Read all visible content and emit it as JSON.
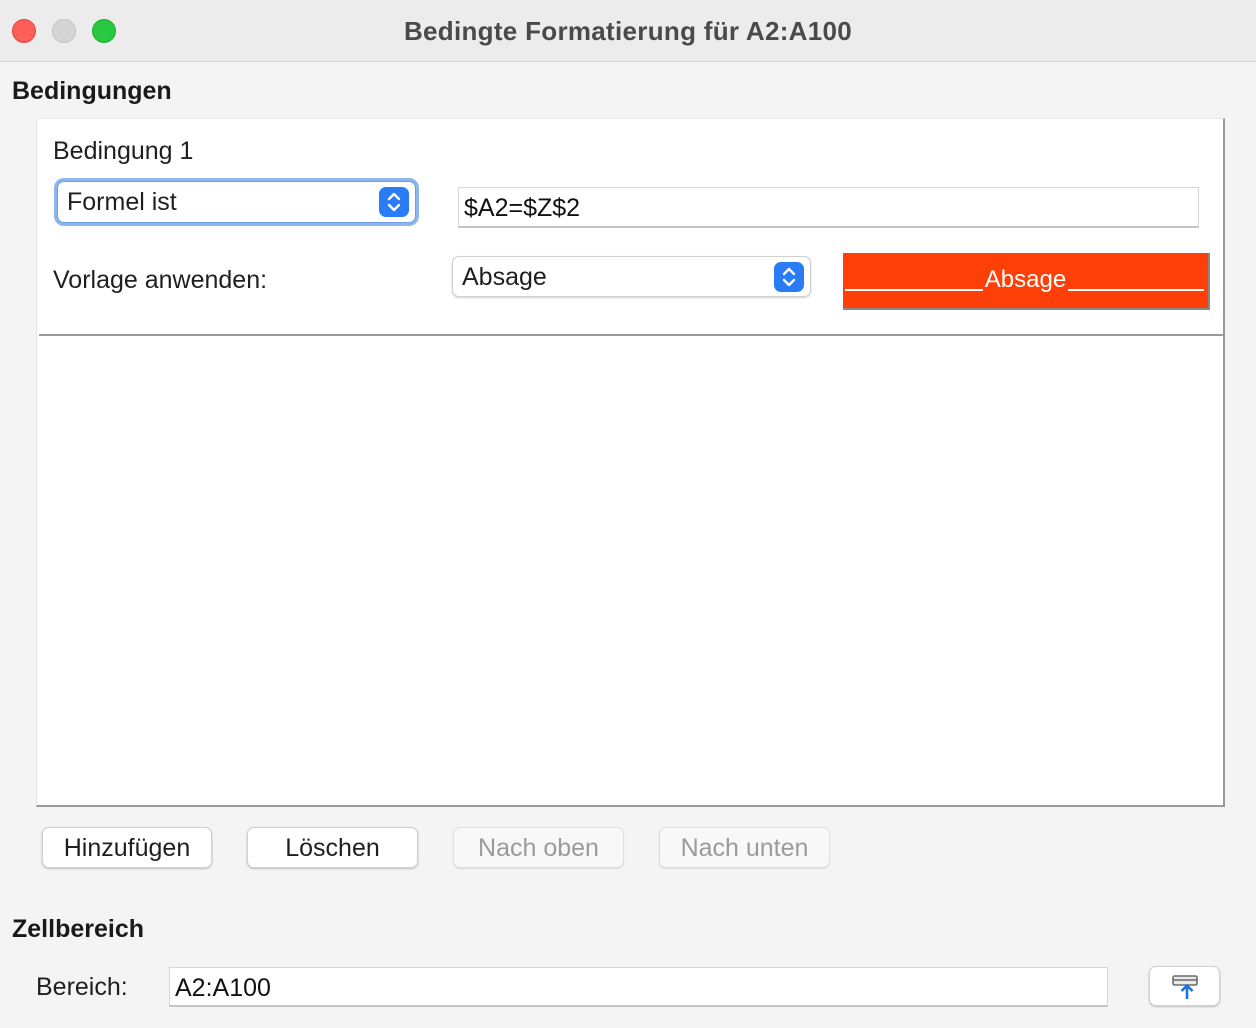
{
  "window": {
    "title": "Bedingte Formatierung für A2:A100"
  },
  "conditions": {
    "heading": "Bedingungen",
    "items": [
      {
        "label": "Bedingung 1",
        "type_selected": "Formel ist",
        "formula": "$A2=$Z$2",
        "style_label": "Vorlage anwenden:",
        "style_selected": "Absage",
        "preview_text": "Absage",
        "preview_color": "#fe3f07"
      }
    ]
  },
  "buttons": {
    "add": "Hinzufügen",
    "delete": "Löschen",
    "move_up": "Nach oben",
    "move_down": "Nach unten"
  },
  "cell_range": {
    "heading": "Zellbereich",
    "label": "Bereich:",
    "value": "A2:A100"
  },
  "icons": {
    "stepper": "up-down-chevron-icon",
    "shrink": "shrink-dialog-icon"
  }
}
